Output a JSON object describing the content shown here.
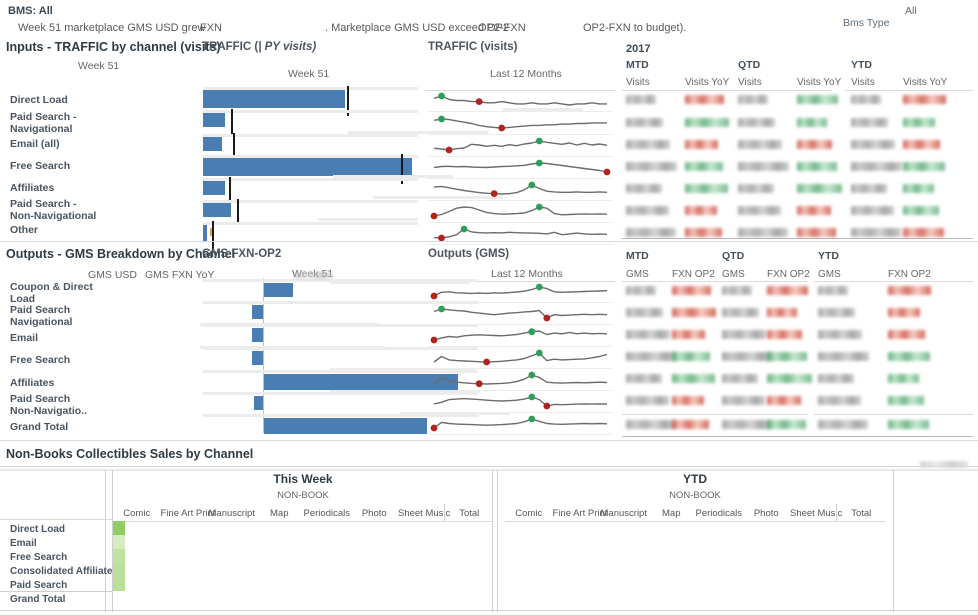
{
  "header": {
    "bms_label": "BMS: All",
    "sentence_parts": [
      "Week 51 marketplace GMS USD grew",
      "FXN",
      ". Marketplace GMS USD exceed OP2",
      "OP2-FXN",
      "OP2-FXN to budget)."
    ],
    "filter_label": "Bms Type",
    "filter_value": "All"
  },
  "traffic": {
    "section_title": "Inputs - TRAFFIC by channel (visits)",
    "left_sub_label": "Week 51",
    "bar_panel_title": "TRAFFIC  (",
    "bar_panel_title_italic": "|  PY visits)",
    "bar_panel_sub": "Week 51",
    "spark_panel_title": "TRAFFIC (visits)",
    "spark_panel_sub": "Last 12 Months",
    "year": "2017",
    "groups": [
      "MTD",
      "QTD",
      "YTD"
    ],
    "metric_columns": [
      "Visits",
      "Visits YoY",
      "Visits",
      "Visits YoY",
      "Visits",
      "Visits YoY"
    ],
    "rows": [
      {
        "label": "Direct Load",
        "label2": ""
      },
      {
        "label": "Paid Search -",
        "label2": "Navigational"
      },
      {
        "label": "Email (all)",
        "label2": ""
      },
      {
        "label": "Free Search",
        "label2": ""
      },
      {
        "label": "Affiliates",
        "label2": ""
      },
      {
        "label": "Paid Search -",
        "label2": "Non-Navigational"
      },
      {
        "label": "Other",
        "label2": ""
      }
    ]
  },
  "gms": {
    "section_title": "Outputs - GMS Breakdown by Channel",
    "left_col_1": "GMS USD",
    "left_col_2": "GMS FXN YoY",
    "bar_panel_title": "GMS FXN-OP2",
    "bar_panel_sub": "Week 51",
    "spark_panel_title": "Outputs (GMS)",
    "spark_panel_sub": "Last 12 Months",
    "groups": [
      "MTD",
      "QTD",
      "YTD"
    ],
    "metric_columns": [
      "GMS",
      "FXN OP2",
      "GMS",
      "FXN OP2",
      "GMS",
      "FXN OP2"
    ],
    "rows": [
      {
        "label": "Coupon & Direct",
        "label2": "Load"
      },
      {
        "label": "Paid Search",
        "label2": "Navigational"
      },
      {
        "label": "Email",
        "label2": ""
      },
      {
        "label": "Free Search",
        "label2": ""
      },
      {
        "label": "Affiliates",
        "label2": ""
      },
      {
        "label": "Paid Search",
        "label2": "Non-Navigatio.."
      },
      {
        "label": "Grand Total",
        "label2": ""
      }
    ]
  },
  "collectibles": {
    "section_title": "Non-Books Collectibles Sales by Channel",
    "period_left": "This Week",
    "period_right": "YTD",
    "category_label": "NON-BOOK",
    "columns": [
      "Comic",
      "Fine Art Print",
      "Manuscript",
      "Map",
      "Periodicals",
      "Photo",
      "Sheet Music",
      "Total"
    ],
    "rows": [
      "Direct Load",
      "Email",
      "Free Search",
      "Consolidated Affiliates",
      "Paid Search",
      "Grand Total"
    ]
  },
  "colors": {
    "bar_blue": "#4a7eb3",
    "positive_green": "#2e9e5b",
    "negative_red": "#b0231f",
    "spark_line": "#6b6b6b",
    "green_cell": "#a8d97e"
  },
  "chart_data": [
    {
      "type": "bar",
      "title": "TRAFFIC (visits) - Week 51",
      "categories": [
        "Direct Load",
        "Paid Search - Navigational",
        "Email (all)",
        "Free Search",
        "Affiliates",
        "Paid Search - Non-Navigational",
        "Other"
      ],
      "values": [
        66,
        10,
        9,
        97,
        10,
        13,
        2
      ],
      "reference_values": [
        67,
        13,
        14,
        92,
        12,
        16,
        4
      ],
      "xlabel": "",
      "ylabel": "",
      "grid": true,
      "legend": false
    },
    {
      "type": "line",
      "title": "TRAFFIC (visits) - Last 12 Months",
      "series": [
        {
          "name": "Direct Load",
          "values": [
            62,
            64,
            61,
            60,
            60,
            59,
            59,
            58,
            58,
            59,
            58,
            57,
            57,
            58,
            57,
            57,
            58,
            57,
            56,
            57,
            57,
            58,
            57,
            57
          ],
          "min_index": 6,
          "max_index": 1
        },
        {
          "name": "Paid Search - Navigational",
          "values": [
            58,
            60,
            59,
            57,
            55,
            53,
            50,
            48,
            47,
            46,
            47,
            48,
            49,
            50,
            50,
            51,
            51,
            52,
            52,
            53,
            53,
            54,
            54,
            54
          ],
          "min_index": 9,
          "max_index": 1
        },
        {
          "name": "Email (all)",
          "values": [
            40,
            38,
            35,
            39,
            41,
            52,
            50,
            46,
            49,
            46,
            51,
            48,
            53,
            56,
            62,
            58,
            55,
            52,
            56,
            50,
            55,
            50,
            53,
            49
          ],
          "min_index": 2,
          "max_index": 14
        },
        {
          "name": "Free Search",
          "values": [
            48,
            52,
            53,
            51,
            52,
            50,
            49,
            48,
            50,
            52,
            53,
            55,
            57,
            62,
            66,
            64,
            60,
            56,
            52,
            48,
            44,
            40,
            36,
            30
          ],
          "min_index": 23,
          "max_index": 14
        },
        {
          "name": "Affiliates",
          "values": [
            56,
            58,
            54,
            50,
            46,
            43,
            40,
            38,
            37,
            36,
            37,
            40,
            48,
            62,
            52,
            44,
            42,
            41,
            41,
            42,
            41,
            41,
            42,
            41
          ],
          "min_index": 8,
          "max_index": 13
        },
        {
          "name": "Paid Search - Non-Navigational",
          "values": [
            40,
            45,
            55,
            66,
            70,
            68,
            60,
            52,
            48,
            46,
            47,
            48,
            50,
            58,
            70,
            66,
            48,
            44,
            45,
            46,
            47,
            46,
            47,
            46
          ],
          "min_index": 0,
          "max_index": 14
        },
        {
          "name": "Other",
          "values": [
            30,
            28,
            34,
            44,
            72,
            58,
            54,
            53,
            54,
            53,
            56,
            54,
            53,
            52,
            51,
            48,
            56,
            44,
            48,
            52,
            48,
            46,
            47,
            46
          ],
          "min_index": 1,
          "max_index": 4
        }
      ],
      "xlabel": "",
      "ylabel": "",
      "grid": false,
      "legend": false
    },
    {
      "type": "bar",
      "title": "GMS FXN-OP2 - Week 51",
      "categories": [
        "Coupon & Direct Load",
        "Paid Search Navigational",
        "Email",
        "Free Search",
        "Affiliates",
        "Paid Search Non-Navigatio..",
        "Grand Total"
      ],
      "values": [
        16,
        -6,
        -6,
        -6,
        108,
        -5,
        91
      ],
      "xlabel": "",
      "ylabel": "",
      "grid": true,
      "legend": false
    },
    {
      "type": "line",
      "title": "Outputs (GMS) - Last 12 Months",
      "series": [
        {
          "name": "Coupon & Direct Load",
          "values": [
            30,
            44,
            46,
            42,
            41,
            40,
            41,
            40,
            42,
            41,
            43,
            45,
            48,
            54,
            64,
            58,
            46,
            44,
            45,
            46,
            47,
            48,
            49,
            50
          ],
          "min_index": 0,
          "max_index": 14
        },
        {
          "name": "Paid Search Navigational",
          "values": [
            56,
            62,
            60,
            58,
            57,
            54,
            52,
            50,
            48,
            50,
            52,
            53,
            55,
            56,
            58,
            40,
            48,
            46,
            47,
            48,
            49,
            48,
            49,
            48
          ],
          "min_index": 15,
          "max_index": 1
        },
        {
          "name": "Email",
          "values": [
            34,
            40,
            44,
            42,
            46,
            48,
            49,
            48,
            47,
            46,
            48,
            50,
            54,
            58,
            60,
            50,
            54,
            52,
            56,
            52,
            54,
            52,
            53,
            52
          ],
          "min_index": 0,
          "max_index": 13
        },
        {
          "name": "Free Search",
          "values": [
            40,
            56,
            46,
            44,
            43,
            42,
            41,
            40,
            41,
            42,
            44,
            46,
            50,
            58,
            66,
            44,
            48,
            46,
            47,
            48,
            49,
            52,
            56,
            62
          ],
          "min_index": 7,
          "max_index": 14
        },
        {
          "name": "Affiliates",
          "values": [
            40,
            58,
            48,
            44,
            42,
            40,
            39,
            38,
            39,
            40,
            42,
            46,
            54,
            68,
            60,
            44,
            42,
            41,
            42,
            43,
            42,
            43,
            44,
            43
          ],
          "min_index": 6,
          "max_index": 13
        },
        {
          "name": "Paid Search Non-Navigatio..",
          "values": [
            44,
            50,
            60,
            62,
            64,
            62,
            60,
            58,
            56,
            55,
            56,
            58,
            62,
            70,
            60,
            36,
            42,
            41,
            42,
            43,
            44,
            43,
            44,
            43
          ],
          "min_index": 15,
          "max_index": 13
        },
        {
          "name": "Grand Total",
          "values": [
            30,
            50,
            46,
            44,
            43,
            42,
            41,
            40,
            41,
            42,
            44,
            46,
            52,
            62,
            54,
            46,
            44,
            43,
            44,
            45,
            46,
            45,
            46,
            45
          ],
          "min_index": 0,
          "max_index": 13
        }
      ],
      "xlabel": "",
      "ylabel": "",
      "grid": false,
      "legend": false
    }
  ]
}
